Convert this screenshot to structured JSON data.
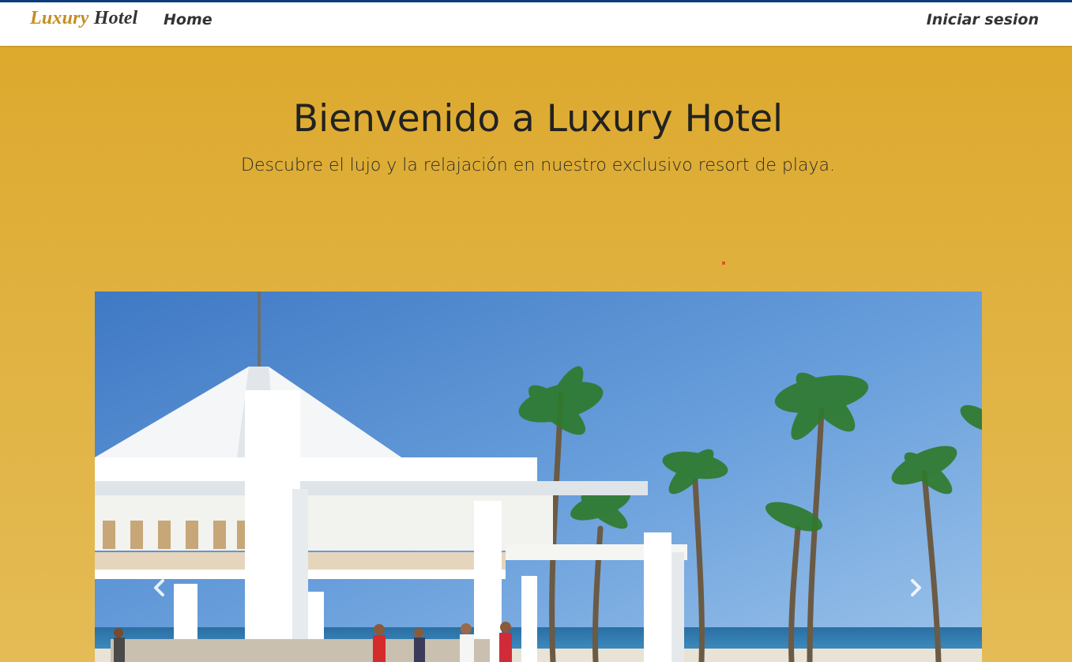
{
  "navbar": {
    "brand_part1": "Luxury",
    "brand_part2": "Hotel",
    "home_label": "Home",
    "login_label": "Iniciar sesion"
  },
  "hero": {
    "title": "Bienvenido a Luxury Hotel",
    "subtitle": "Descubre el lujo y la relajación en nuestro exclusivo resort de playa."
  },
  "carousel": {
    "image_alt": "Resort de playa con pérgola blanca y palmeras",
    "prev_icon": "chevron-left-icon",
    "next_icon": "chevron-right-icon"
  },
  "colors": {
    "background": "#DCA82A",
    "brand_gold": "#C58E1E",
    "text_dark": "#222222",
    "nav_border": "#0b3d7a"
  }
}
